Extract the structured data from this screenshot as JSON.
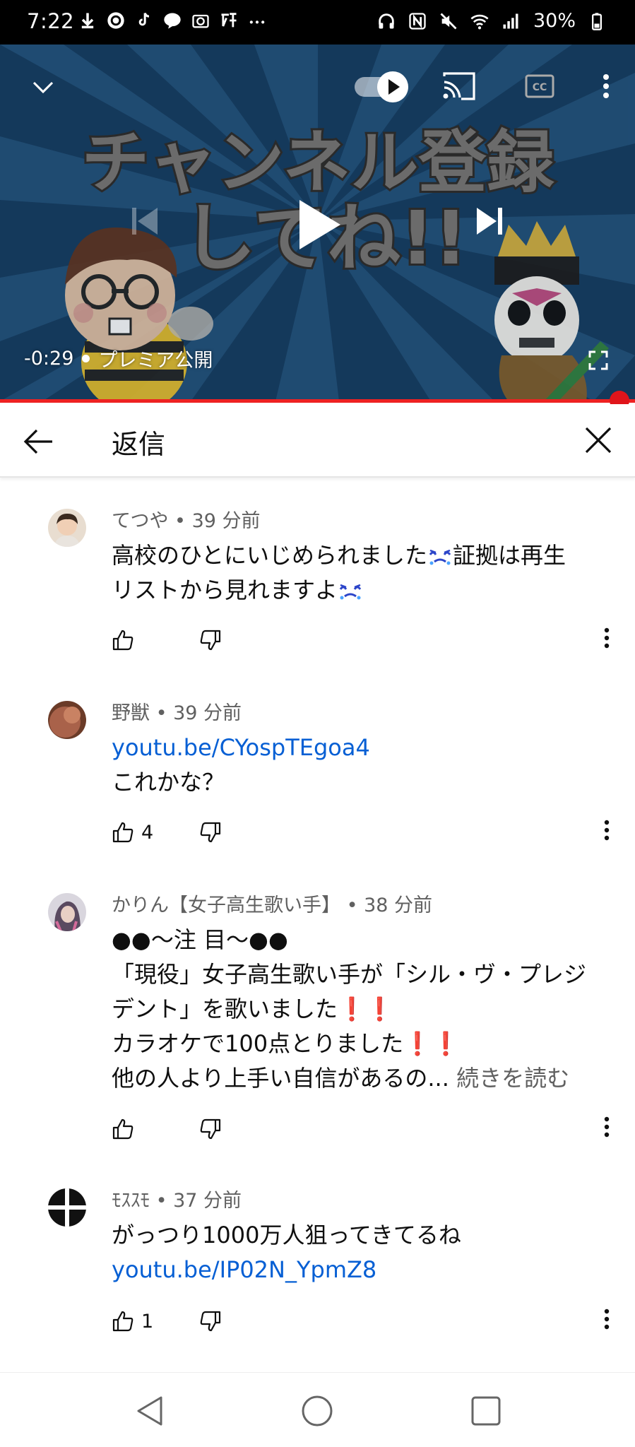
{
  "status_bar": {
    "time": "7:22",
    "battery": "30%",
    "left_icons": [
      "download-icon",
      "sync-icon",
      "tiktok-icon",
      "line-icon",
      "camera-icon",
      "app-icon",
      "more-notifications-icon"
    ],
    "right_icons": [
      "headphones-icon",
      "nfc-icon",
      "mute-icon",
      "wifi-icon",
      "signal-icon",
      "battery-icon"
    ]
  },
  "player": {
    "thumbnail_text_line1": "チャンネル登録",
    "thumbnail_text_line2": "してね!!",
    "time_remaining": "-0:29",
    "premiere_label": "プレミア公開",
    "progress": 1.0,
    "colors": {
      "progress": "#e0151b",
      "background": "#1c4b78"
    }
  },
  "replies_header": {
    "title": "返信"
  },
  "comments": [
    {
      "author": "てつや",
      "time": "39 分前",
      "lines": [
        "高校のひとにいじめられました",
        "証拠は再生",
        "リストから見れますよ"
      ],
      "link": "",
      "like_count": ""
    },
    {
      "author": "野獣",
      "time": "39 分前",
      "link": "youtu.be/CYospTEgoa4",
      "lines": [
        "これかな？"
      ],
      "like_count": "4"
    },
    {
      "author": "かりん【女子高生歌い手】",
      "time": "38 分前",
      "lines": [
        "●●～注 目～●●",
        "「現役」女子高生歌い手が「シル・ヴ・プレジ",
        "デント」を歌いました",
        "カラオケで100点とりました",
        "他の人より上手い自信があるの..."
      ],
      "read_more": "続きを読む",
      "like_count": ""
    },
    {
      "author": "ﾓｽｽﾓ",
      "time": "37 分前",
      "lines": [
        "がっつり1000万人狙ってきてるね"
      ],
      "link": "youtu.be/IP02N_YpmZ8",
      "like_count": "1"
    }
  ],
  "separator": " • ",
  "emphasis": "❗❗",
  "colors": {
    "link": "#065fd4",
    "meta": "#606060",
    "text": "#0f0f0f"
  }
}
